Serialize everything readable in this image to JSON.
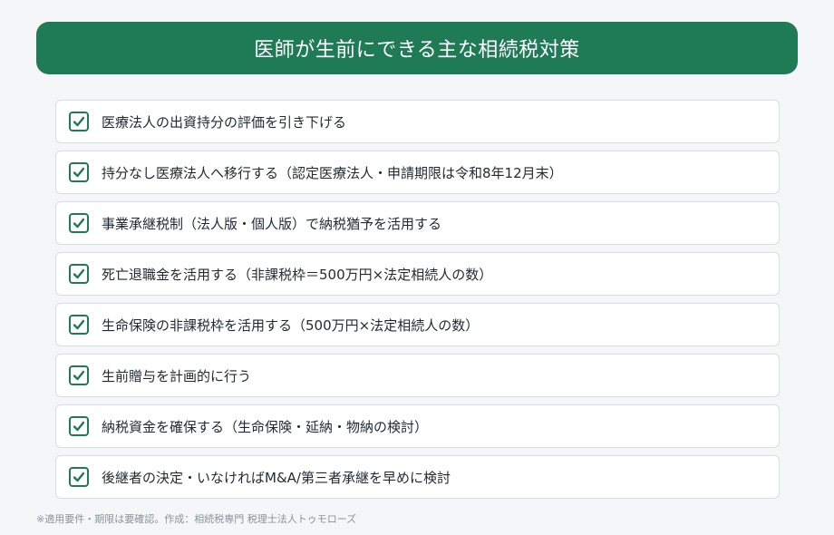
{
  "header": {
    "title": "医師が生前にできる主な相続税対策"
  },
  "colors": {
    "accent": "#1f7a56",
    "card_border": "#d7dde3",
    "background": "#f4f6f8"
  },
  "items": [
    {
      "label": "医療法人の出資持分の評価を引き下げる",
      "icon": "checkbox-checked-icon"
    },
    {
      "label": "持分なし医療法人へ移行する（認定医療法人・申請期限は令和8年12月末）",
      "icon": "checkbox-checked-icon"
    },
    {
      "label": "事業承継税制（法人版・個人版）で納税猶予を活用する",
      "icon": "checkbox-checked-icon"
    },
    {
      "label": "死亡退職金を活用する（非課税枠＝500万円×法定相続人の数）",
      "icon": "checkbox-checked-icon"
    },
    {
      "label": "生命保険の非課税枠を活用する（500万円×法定相続人の数）",
      "icon": "checkbox-checked-icon"
    },
    {
      "label": "生前贈与を計画的に行う",
      "icon": "checkbox-checked-icon"
    },
    {
      "label": "納税資金を確保する（生命保険・延納・物納の検討）",
      "icon": "checkbox-checked-icon"
    },
    {
      "label": "後継者の決定・いなければM&A/第三者承継を早めに検討",
      "icon": "checkbox-checked-icon"
    }
  ],
  "footnote": "※適用要件・期限は要確認。作成：相続税専門 税理士法人トゥモローズ"
}
